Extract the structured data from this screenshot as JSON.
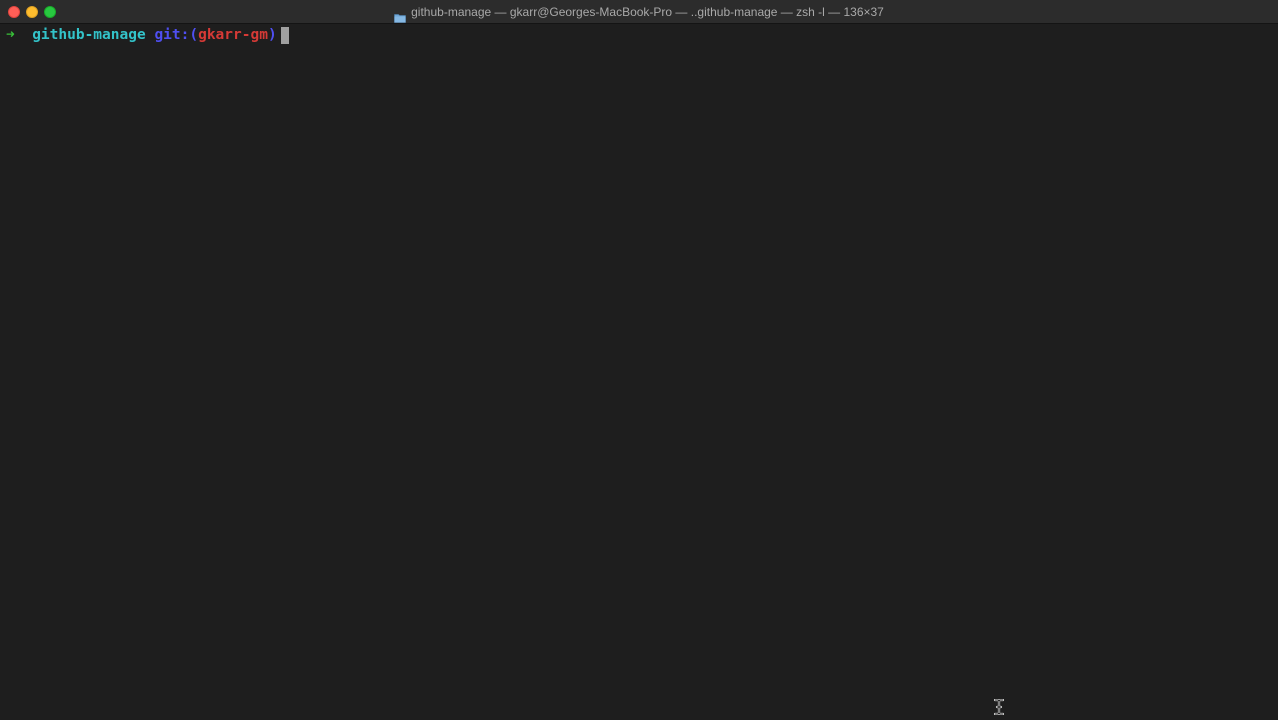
{
  "window": {
    "title": "github-manage — gkarr@Georges-MacBook-Pro — ..github-manage — zsh -l — 136×37",
    "icon": "folder-icon",
    "controls": {
      "close_color": "#ff5f57",
      "minimize_color": "#febc2e",
      "zoom_color": "#28c840"
    }
  },
  "terminal": {
    "background": "#1e1e1e",
    "prompt": {
      "arrow": "➜",
      "directory": "github-manage",
      "git_prefix": "git:(",
      "branch": "gkarr-gm",
      "git_suffix": ")",
      "colors": {
        "arrow": "#38c038",
        "directory": "#33c3c9",
        "git": "#4f4ff2",
        "branch": "#d63a36"
      }
    },
    "cursor_color": "#a0a0a0"
  },
  "mouse": {
    "cursor": "ibeam-cursor-icon"
  }
}
